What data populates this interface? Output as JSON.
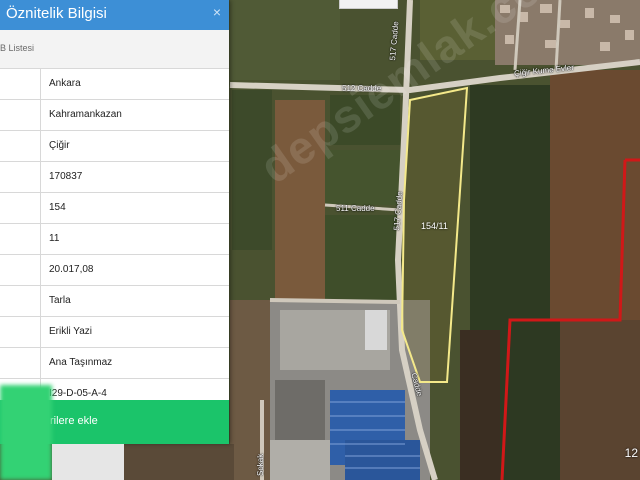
{
  "panel": {
    "title": "Öznitelik Bilgisi",
    "close_symbol": "×",
    "list_title": "B Listesi",
    "rows": [
      {
        "value": "Ankara"
      },
      {
        "value": "Kahramankazan"
      },
      {
        "value": "Çiğir"
      },
      {
        "value": "170837"
      },
      {
        "value": "154"
      },
      {
        "value": "11"
      },
      {
        "value": "20.017,08"
      },
      {
        "value": "Tarla"
      },
      {
        "value": "Erikli Yazi"
      },
      {
        "value": "Ana Taşınmaz"
      },
      {
        "value": "I29-D-05-A-4"
      }
    ],
    "add_button_label": "rilere ekle"
  },
  "map": {
    "roads": {
      "road_512": "512 Cadde",
      "road_511": "511 Cadde",
      "road_517_upper": "517 Cadde",
      "road_517_lower": "517 Cadde",
      "road_cigir": "Çiğir Kume Evler",
      "road_lower": "Cadde",
      "road_bottom": "Sokak"
    },
    "parcel_label": "154/11",
    "watermark": "depsiemlak.com",
    "scale_label": "12",
    "colors": {
      "parcel_outline": "#f4e98a",
      "boundary_red": "#d01818",
      "panel_header": "#3d8fd6",
      "add_button": "#1bc46a"
    }
  }
}
